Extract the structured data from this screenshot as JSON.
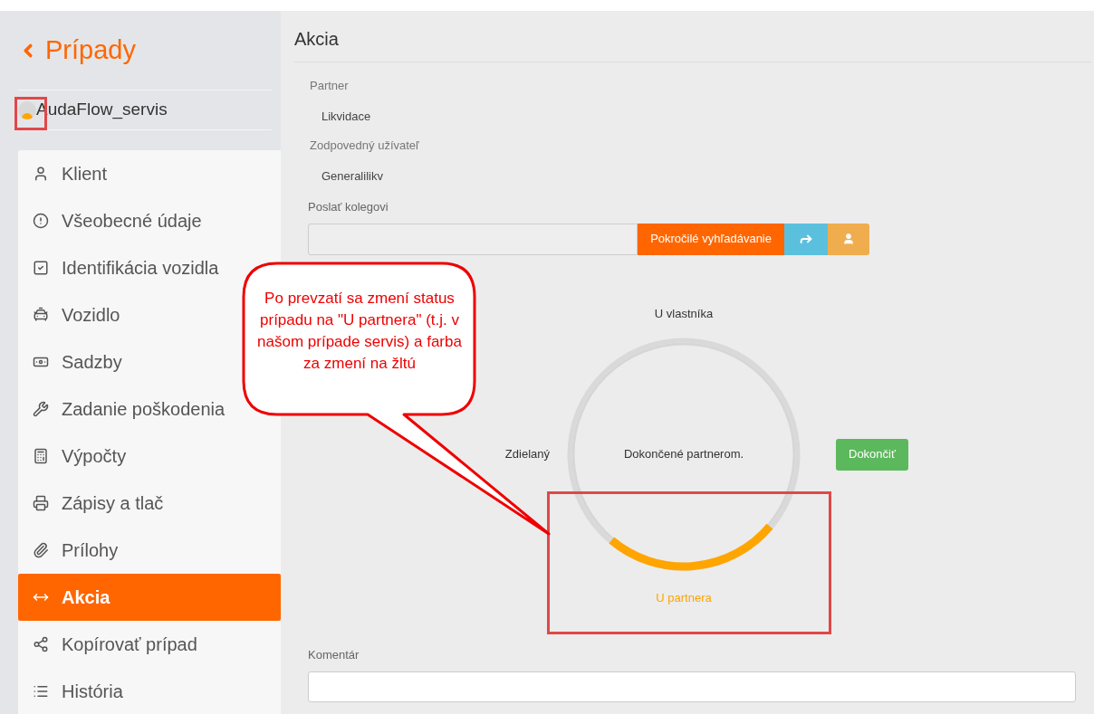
{
  "sidebar": {
    "back_title": "Prípady",
    "user": "AudaFlow_servis",
    "items": [
      {
        "label": "Klient",
        "selected": false
      },
      {
        "label": "Všeobecné údaje",
        "selected": false
      },
      {
        "label": "Identifikácia vozidla",
        "selected": false
      },
      {
        "label": "Vozidlo",
        "selected": false
      },
      {
        "label": "Sadzby",
        "selected": false
      },
      {
        "label": "Zadanie poškodenia",
        "selected": false
      },
      {
        "label": "Výpočty",
        "selected": false
      },
      {
        "label": "Zápisy a tlač",
        "selected": false
      },
      {
        "label": "Prílohy",
        "selected": false
      },
      {
        "label": "Akcia",
        "selected": true
      },
      {
        "label": "Kopírovať prípad",
        "selected": false
      },
      {
        "label": "História",
        "selected": false
      }
    ]
  },
  "main": {
    "title": "Akcia",
    "fields": [
      {
        "label": "Partner",
        "value": "Likvidace"
      },
      {
        "label": "Zodpovedný užívateľ",
        "value": "Generalilikv"
      }
    ],
    "send": {
      "label": "Poslať kolegovi",
      "search_button": "Pokročilé vyhľadávanie"
    },
    "status": {
      "center": "Dokončené partnerom.",
      "stages": [
        {
          "label": "U vlastníka",
          "kind": "top",
          "selected": false
        },
        {
          "label": "Zdielaný",
          "kind": "left",
          "selected": false
        },
        {
          "label": "U partnera",
          "kind": "bottom",
          "selected": true
        }
      ],
      "finish_button": "Dokončiť"
    },
    "comment": {
      "label": "Komentár"
    }
  },
  "callout": {
    "text": "Po prevzatí sa zmení status prípadu na \"U partnera\" (t.j. v našom prípade servis) a farba  za zmení na žltú"
  }
}
